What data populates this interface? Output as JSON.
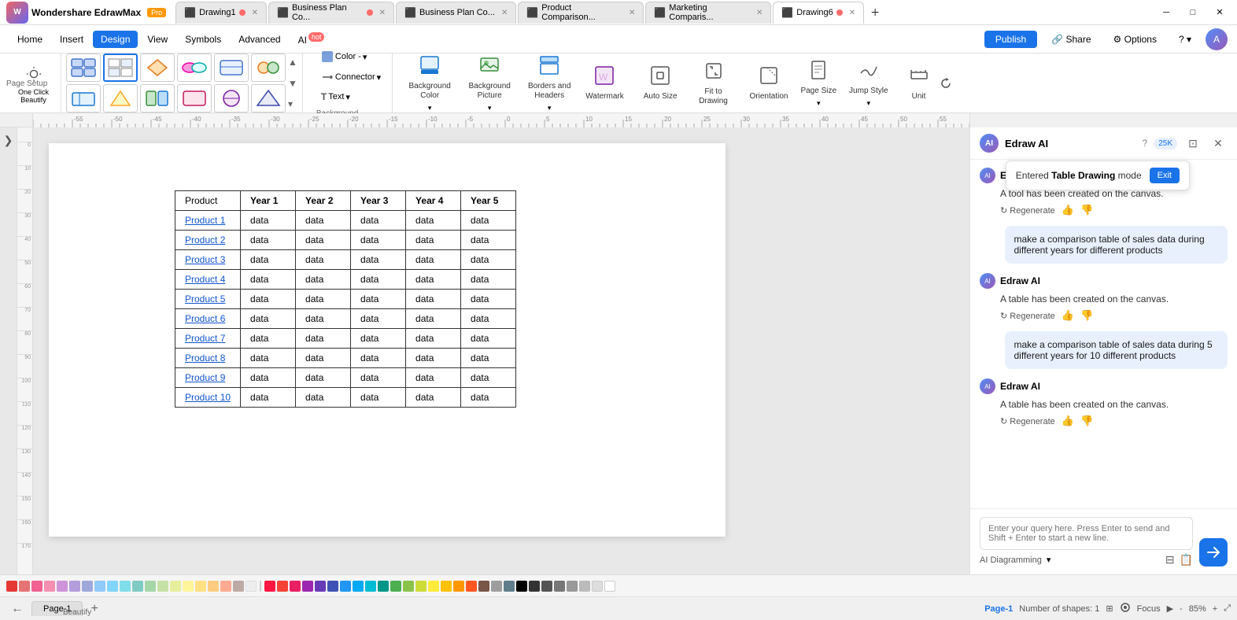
{
  "title_bar": {
    "app_name": "Wondershare EdrawMax",
    "pro_badge": "Pro",
    "tabs": [
      {
        "label": "Drawing1",
        "active": false,
        "dot_color": "#ff6b6b"
      },
      {
        "label": "Business Plan Co...",
        "active": false,
        "dot_color": "#ff6b6b"
      },
      {
        "label": "Business Plan Co...",
        "active": false,
        "dot_color": null
      },
      {
        "label": "Product Comparison...",
        "active": false,
        "dot_color": null
      },
      {
        "label": "Marketing Comparis...",
        "active": false,
        "dot_color": null
      },
      {
        "label": "Drawing6",
        "active": true,
        "dot_color": "#ff6b6b"
      }
    ],
    "window_controls": [
      "─",
      "□",
      "✕"
    ]
  },
  "menu_bar": {
    "items": [
      "Home",
      "Insert",
      "Design",
      "View",
      "Symbols",
      "Advanced"
    ],
    "active_item": "Design",
    "ai_label": "AI",
    "hot_badge": "hot",
    "right": {
      "publish": "Publish",
      "share": "Share",
      "options": "Options",
      "help": "?"
    }
  },
  "toolbar": {
    "beautify_label": "Beautify",
    "one_click_label": "One Click\nBeautify",
    "background_label": "Background",
    "page_setup_label": "Page Setup",
    "color_label": "Color -",
    "connector_label": "Connector",
    "background_color_label": "Background\nColor",
    "background_picture_label": "Background\nPicture",
    "borders_headers_label": "Borders and\nHeaders",
    "watermark_label": "Watermark",
    "auto_size_label": "Auto\nSize",
    "fit_to_drawing_label": "Fit to\nDrawing",
    "orientation_label": "Orientation",
    "page_size_label": "Page\nSize",
    "jump_style_label": "Jump\nStyle",
    "unit_label": "Unit"
  },
  "canvas": {
    "ruler_start": -60,
    "ruler_end": 320,
    "table": {
      "headers": [
        "Product",
        "Year 1",
        "Year 2",
        "Year 3",
        "Year 4",
        "Year 5"
      ],
      "rows": [
        [
          "Product 1",
          "data",
          "data",
          "data",
          "data",
          "data"
        ],
        [
          "Product 2",
          "data",
          "data",
          "data",
          "data",
          "data"
        ],
        [
          "Product 3",
          "data",
          "data",
          "data",
          "data",
          "data"
        ],
        [
          "Product 4",
          "data",
          "data",
          "data",
          "data",
          "data"
        ],
        [
          "Product 5",
          "data",
          "data",
          "data",
          "data",
          "data"
        ],
        [
          "Product 6",
          "data",
          "data",
          "data",
          "data",
          "data"
        ],
        [
          "Product 7",
          "data",
          "data",
          "data",
          "data",
          "data"
        ],
        [
          "Product 8",
          "data",
          "data",
          "data",
          "data",
          "data"
        ],
        [
          "Product 9",
          "data",
          "data",
          "data",
          "data",
          "data"
        ],
        [
          "Product 10",
          "data",
          "data",
          "data",
          "data",
          "data"
        ]
      ]
    }
  },
  "ai_panel": {
    "title": "Edraw AI",
    "badge": "25K",
    "messages": [
      {
        "type": "bot",
        "text": "A tool has been created on the canvas.",
        "regen": "Regenerate"
      },
      {
        "type": "user",
        "text": "make a comparison table of sales data during different years for different products"
      },
      {
        "type": "bot",
        "text": "A table has been created on the canvas.",
        "regen": "Regenerate"
      },
      {
        "type": "user",
        "text": "make a comparison table of sales data during 5 different years for 10 different products"
      },
      {
        "type": "bot",
        "text": "A table has been created on the canvas.",
        "regen": "Regenerate"
      }
    ],
    "tooltip": {
      "text": "Entered",
      "mode": "Table Drawing",
      "mode_suffix": "mode",
      "exit_btn": "Exit"
    },
    "input_placeholder": "Enter your query here. Press Enter to send and Shift + Enter to start a new line.",
    "mode_label": "AI Diagramming"
  },
  "status_bar": {
    "page_label": "Page-1",
    "page_active": "Page-1",
    "shapes_count": "Number of shapes: 1",
    "focus_label": "Focus",
    "zoom_level": "85%"
  },
  "color_palette": [
    "#e53935",
    "#e57373",
    "#f06292",
    "#f48fb1",
    "#ce93d8",
    "#b39ddb",
    "#9fa8da",
    "#90caf9",
    "#81d4fa",
    "#80deea",
    "#80cbc4",
    "#a5d6a7",
    "#c5e1a5",
    "#e6ee9c",
    "#fff59d",
    "#ffe082",
    "#ffcc80",
    "#ffab91",
    "#bcaaa4",
    "#eeeeee",
    "#ff1744",
    "#f44336",
    "#e91e63",
    "#9c27b0",
    "#673ab7",
    "#3f51b5",
    "#2196f3",
    "#03a9f4",
    "#00bcd4",
    "#009688",
    "#4caf50",
    "#8bc34a",
    "#cddc39",
    "#ffeb3b",
    "#ffc107",
    "#ff9800",
    "#ff5722",
    "#795548",
    "#9e9e9e",
    "#607d8b",
    "#000000",
    "#333333",
    "#555555",
    "#777777",
    "#999999",
    "#bbbbbb",
    "#dddddd",
    "#ffffff"
  ]
}
